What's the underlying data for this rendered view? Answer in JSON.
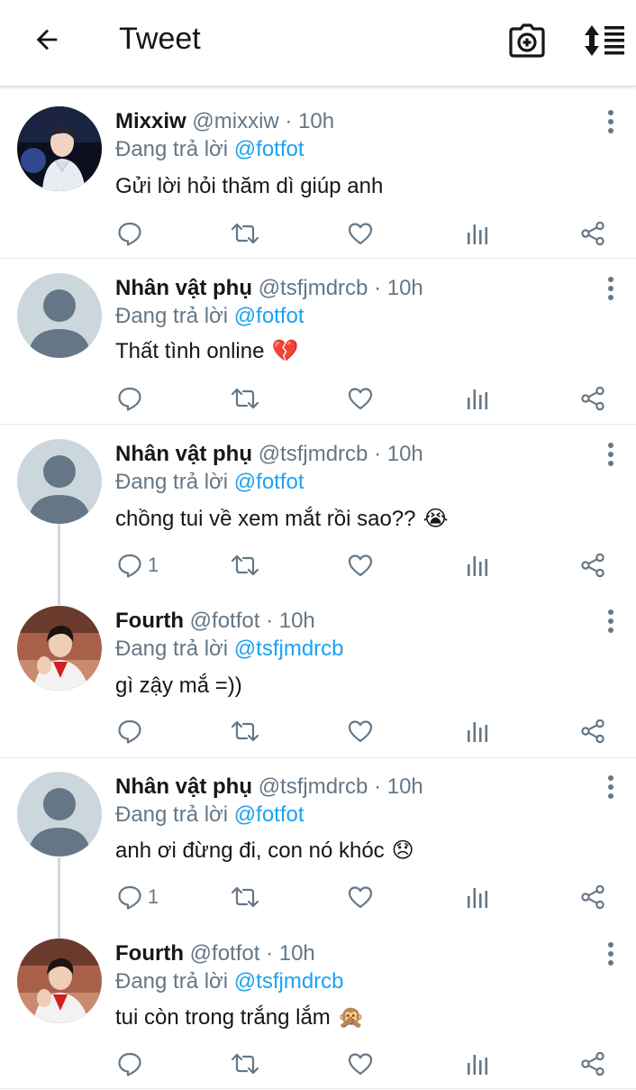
{
  "header": {
    "title": "Tweet",
    "back_icon": "arrow-left-icon",
    "camera_icon": "camera-plus-icon",
    "sort_icon": "sort-icon"
  },
  "reply_prefix": "Đang trả lời",
  "tweets": [
    {
      "name": "Mixxiw",
      "handle": "@mixxiw",
      "time": "· 10h",
      "reply_to": "@fotfot",
      "text": "Gửi lời hỏi thăm dì giúp anh",
      "emoji": "",
      "reply_count": "",
      "avatar": "photo-boy-white-jacket"
    },
    {
      "name": "Nhân vật phụ",
      "handle": "@tsfjmdrcb",
      "time": "· 10h",
      "reply_to": "@fotfot",
      "text": "Thất tình online",
      "emoji": "💔",
      "reply_count": "",
      "avatar": "default-profile"
    },
    {
      "name": "Nhân vật phụ",
      "handle": "@tsfjmdrcb",
      "time": "· 10h",
      "reply_to": "@fotfot",
      "text": "chồng tui về xem mắt rồi sao??",
      "emoji": "😭",
      "reply_count": "1",
      "avatar": "default-profile"
    },
    {
      "name": "Fourth",
      "handle": "@fotfot",
      "time": "· 10h",
      "reply_to": "@tsfjmdrcb",
      "text": "gì zậy mắ =))",
      "emoji": "",
      "reply_count": "",
      "avatar": "photo-boy-red-shirt"
    },
    {
      "name": "Nhân vật phụ",
      "handle": "@tsfjmdrcb",
      "time": "· 10h",
      "reply_to": "@fotfot",
      "text": "anh ơi đừng đi, con nó khóc",
      "emoji": "😞",
      "reply_count": "1",
      "avatar": "default-profile"
    },
    {
      "name": "Fourth",
      "handle": "@fotfot",
      "time": "· 10h",
      "reply_to": "@tsfjmdrcb",
      "text": "tui còn trong trắng lắm",
      "emoji": "🙊",
      "reply_count": "",
      "avatar": "photo-boy-red-shirt"
    }
  ],
  "colors": {
    "link": "#1da1f2",
    "muted": "#657786",
    "text": "#14171a",
    "divider": "#e1e8ed"
  }
}
